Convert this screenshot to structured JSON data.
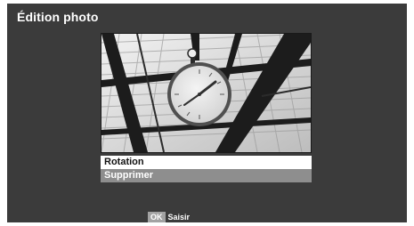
{
  "dialog": {
    "title": "Édition photo"
  },
  "photo": {
    "subject": "station-clock-under-glass-roof"
  },
  "menu": {
    "items": [
      {
        "label": "Rotation",
        "selected": true
      },
      {
        "label": "Supprimer",
        "selected": false
      }
    ]
  },
  "footer": {
    "key": "OK",
    "action": "Saisir"
  },
  "colors": {
    "panel": "#3b3b3b",
    "selected_bg": "#ffffff",
    "item_bg": "#8e8e8e",
    "key_bg": "#a3a3a3"
  }
}
